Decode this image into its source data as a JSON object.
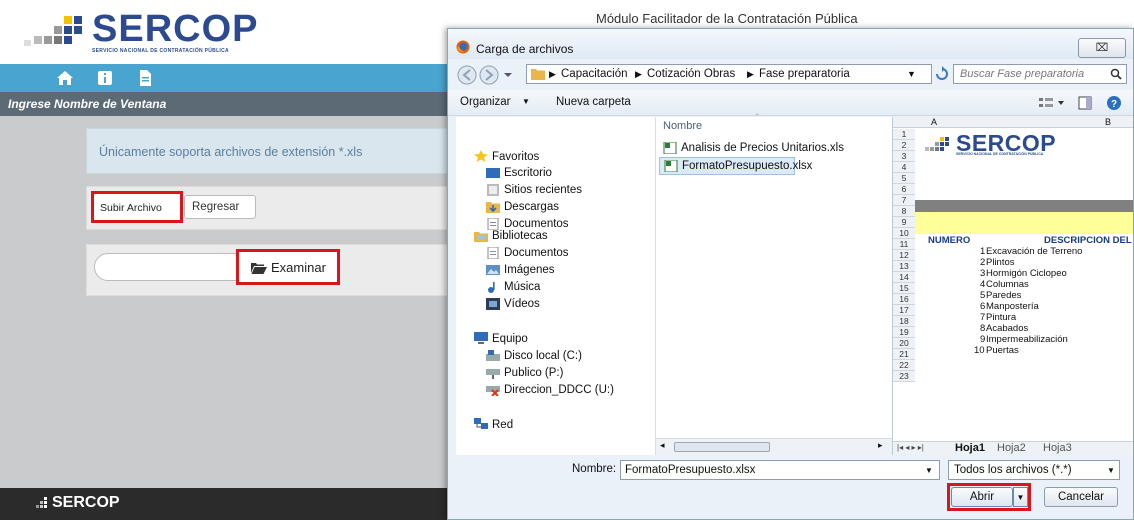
{
  "app": {
    "logo_text": "SERCOP",
    "logo_sub": "SERVICIO NACIONAL DE CONTRATACIÓN PÚBLICA",
    "module_title": "Módulo Facilitador de la Contratación Pública",
    "window_title": "Ingrese Nombre de Ventana",
    "info_message": "Únicamente soporta archivos de extensión *.xls",
    "subir_label": "Subir Archivo",
    "regresar_label": "Regresar",
    "examinar_label": "Examinar",
    "footer_logo": "SERCOP",
    "nav_icons": [
      "home-icon",
      "info-icon",
      "document-icon"
    ],
    "accent_color": "#4aa4d0",
    "highlight_color": "#d8161c"
  },
  "dialog": {
    "title": "Carga de archivos",
    "close_label": "⌧",
    "breadcrumb": [
      "Capacitación",
      "Cotización Obras",
      "Fase preparatoria"
    ],
    "search_placeholder": "Buscar Fase preparatoria",
    "organize_label": "Organizar",
    "new_folder_label": "Nueva carpeta",
    "column_name": "Nombre",
    "nav": {
      "favoritos": "Favoritos",
      "escritorio": "Escritorio",
      "sitios": "Sitios recientes",
      "descargas": "Descargas",
      "documentos1": "Documentos",
      "bibliotecas": "Bibliotecas",
      "documentos2": "Documentos",
      "imagenes": "Imágenes",
      "musica": "Música",
      "videos": "Vídeos",
      "equipo": "Equipo",
      "disco": "Disco local (C:)",
      "publico": "Publico (P:)",
      "direccion": "Direccion_DDCC (U:)",
      "red": "Red"
    },
    "files": [
      "Analisis de Precios Unitarios.xls",
      "FormatoPresupuesto.xlsx"
    ],
    "filename_label": "Nombre:",
    "filename_value": "FormatoPresupuesto.xlsx",
    "filetype_value": "Todos los archivos (*.*)",
    "open_label": "Abrir",
    "cancel_label": "Cancelar"
  },
  "preview": {
    "col_a": "A",
    "col_b": "B",
    "logo_text": "SERCOP",
    "header_numero": "NUMERO",
    "header_desc": "DESCRIPCION DEL",
    "rows": [
      "1",
      "2",
      "3",
      "4",
      "5",
      "6",
      "7",
      "8",
      "9",
      "10",
      "11",
      "12",
      "13",
      "14",
      "15",
      "16",
      "17",
      "18",
      "19",
      "20",
      "21",
      "22",
      "23"
    ],
    "items": [
      {
        "n": "1",
        "desc": "Excavación de Terreno"
      },
      {
        "n": "2",
        "desc": "Plintos"
      },
      {
        "n": "3",
        "desc": "Hormigón Ciclopeo"
      },
      {
        "n": "4",
        "desc": "Columnas"
      },
      {
        "n": "5",
        "desc": "Paredes"
      },
      {
        "n": "6",
        "desc": "Manpostería"
      },
      {
        "n": "7",
        "desc": "Pintura"
      },
      {
        "n": "8",
        "desc": "Acabados"
      },
      {
        "n": "9",
        "desc": "Impermeabilización"
      },
      {
        "n": "10",
        "desc": "Puertas"
      }
    ],
    "sheets": [
      "Hoja1",
      "Hoja2",
      "Hoja3"
    ]
  }
}
